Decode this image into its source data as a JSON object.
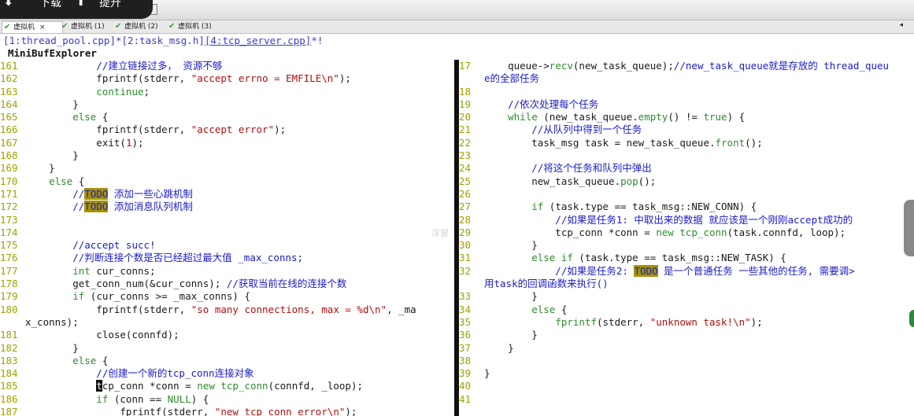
{
  "overlay": {
    "download_label": "下载",
    "submit_label": "提升"
  },
  "toolbar_icons": [
    "copy-icon",
    "paste-icon",
    "cut-icon",
    "undo-icon",
    "redo-icon",
    "print-icon",
    "properties-icon",
    "tools-icon",
    "light-icon",
    "help-icon",
    "display-icon"
  ],
  "vm_tabs": [
    {
      "label": "虚拟机",
      "close": "×"
    },
    {
      "label": "虚拟机 (1)"
    },
    {
      "label": "虚拟机 (2)"
    },
    {
      "label": "虚拟机 (3)"
    }
  ],
  "tab_arrow": "◂",
  "buffers": {
    "b1": "[1:thread_pool.cpp]*",
    "b2": "[2:task_msg.h]",
    "b3": "[4:tcp_server.cpp]",
    "b3_suffix": "*!"
  },
  "minibuf_title": "MiniBufExplorer",
  "watermark_text": "浮窗",
  "left_lines": [
    [
      "161",
      [
        [
          "c",
          "            //建立链接过多， 资源不够"
        ]
      ]
    ],
    [
      "162",
      [
        [
          "t",
          "            fprintf(stderr, "
        ],
        [
          "s",
          "\"accept errno = EMFILE\\n\""
        ],
        [
          "t",
          ");"
        ]
      ]
    ],
    [
      "163",
      [
        [
          "k",
          "            continue"
        ],
        [
          "t",
          ";"
        ]
      ]
    ],
    [
      "164",
      [
        [
          "t",
          "        }"
        ]
      ]
    ],
    [
      "165",
      [
        [
          "k",
          "        else"
        ],
        [
          "t",
          " {"
        ]
      ]
    ],
    [
      "166",
      [
        [
          "t",
          "            fprintf(stderr, "
        ],
        [
          "s",
          "\"accept error\""
        ],
        [
          "t",
          ");"
        ]
      ]
    ],
    [
      "167",
      [
        [
          "t",
          "            exit("
        ],
        [
          "s",
          "1"
        ],
        [
          "t",
          ");"
        ]
      ]
    ],
    [
      "168",
      [
        [
          "t",
          "        }"
        ]
      ]
    ],
    [
      "169",
      [
        [
          "t",
          "    }"
        ]
      ]
    ],
    [
      "170",
      [
        [
          "k",
          "    else"
        ],
        [
          "t",
          " {"
        ]
      ]
    ],
    [
      "171",
      [
        [
          "c",
          "        //"
        ],
        [
          "o",
          "TODO"
        ],
        [
          "c",
          " 添加一些心跳机制"
        ]
      ]
    ],
    [
      "172",
      [
        [
          "c",
          "        //"
        ],
        [
          "o",
          "TODO"
        ],
        [
          "c",
          " 添加消息队列机制"
        ]
      ]
    ],
    [
      "173",
      []
    ],
    [
      "174",
      []
    ],
    [
      "175",
      [
        [
          "c",
          "        //accept succ!"
        ]
      ]
    ],
    [
      "176",
      [
        [
          "c",
          "        //判断连接个数是否已经超过最大值 _max_conns;"
        ]
      ]
    ],
    [
      "177",
      [
        [
          "k",
          "        int"
        ],
        [
          "t",
          " cur_conns;"
        ]
      ]
    ],
    [
      "178",
      [
        [
          "t",
          "        get_conn_num(&cur_conns); "
        ],
        [
          "c",
          "//获取当前在线的连接个数"
        ]
      ]
    ],
    [
      "179",
      [
        [
          "k",
          "        if"
        ],
        [
          "t",
          " (cur_conns >= _max_conns) {"
        ]
      ]
    ],
    [
      "180",
      [
        [
          "t",
          "            fprintf(stderr, "
        ],
        [
          "s",
          "\"so many connections, max = %d\\n\""
        ],
        [
          "t",
          ", _ma"
        ]
      ]
    ],
    [
      "",
      [
        [
          "t",
          "x_conns);"
        ]
      ]
    ],
    [
      "181",
      [
        [
          "t",
          "            close(connfd);"
        ]
      ]
    ],
    [
      "182",
      [
        [
          "t",
          "        }"
        ]
      ]
    ],
    [
      "183",
      [
        [
          "k",
          "        else"
        ],
        [
          "t",
          " {"
        ]
      ]
    ],
    [
      "184",
      [
        [
          "c",
          "            //创建一个新的tcp_conn连接对象"
        ]
      ]
    ],
    [
      "185",
      [
        [
          "t",
          "            "
        ],
        [
          "u",
          "t"
        ],
        [
          "t",
          "cp_conn *conn = "
        ],
        [
          "k",
          "new"
        ],
        [
          "t",
          " "
        ],
        [
          "k",
          "tcp_conn"
        ],
        [
          "t",
          "(connfd, _loop);"
        ]
      ]
    ],
    [
      "186",
      [
        [
          "k",
          "            if"
        ],
        [
          "t",
          " (conn == "
        ],
        [
          "k",
          "NULL"
        ],
        [
          "t",
          ") {"
        ]
      ]
    ],
    [
      "187",
      [
        [
          "t",
          "                fprintf(stderr, "
        ],
        [
          "s",
          "\"new tcp_conn error\\n\""
        ],
        [
          "t",
          ");"
        ]
      ]
    ]
  ],
  "right_lines": [
    [
      "17",
      [
        [
          "t",
          "    queue->"
        ],
        [
          "k",
          "recv"
        ],
        [
          "t",
          "(new_task_queue);"
        ],
        [
          "c",
          "//new_task_queue就是存放的 thread_queu"
        ]
      ]
    ],
    [
      "",
      [
        [
          "c",
          "e的全部任务"
        ]
      ]
    ],
    [
      "18",
      []
    ],
    [
      "19",
      [
        [
          "c",
          "    //依次处理每个任务"
        ]
      ]
    ],
    [
      "20",
      [
        [
          "k",
          "    while"
        ],
        [
          "t",
          " (new_task_queue."
        ],
        [
          "k",
          "empty"
        ],
        [
          "t",
          "() != "
        ],
        [
          "k",
          "true"
        ],
        [
          "t",
          ") {"
        ]
      ]
    ],
    [
      "21",
      [
        [
          "c",
          "        //从队列中得到一个任务"
        ]
      ]
    ],
    [
      "22",
      [
        [
          "t",
          "        task_msg task = new_task_queue."
        ],
        [
          "k",
          "front"
        ],
        [
          "t",
          "();"
        ]
      ]
    ],
    [
      "23",
      []
    ],
    [
      "24",
      [
        [
          "c",
          "        //将这个任务和队列中弹出"
        ]
      ]
    ],
    [
      "25",
      [
        [
          "t",
          "        new_task_queue."
        ],
        [
          "k",
          "pop"
        ],
        [
          "t",
          "();"
        ]
      ]
    ],
    [
      "26",
      []
    ],
    [
      "27",
      [
        [
          "k",
          "        if"
        ],
        [
          "t",
          " (task.type == task_msg::NEW_CONN) {"
        ]
      ]
    ],
    [
      "28",
      [
        [
          "c",
          "            //如果是任务1: 中取出来的数据 就应该是一个刚刚accept成功的"
        ]
      ]
    ],
    [
      "29",
      [
        [
          "t",
          "            tcp_conn *conn = "
        ],
        [
          "k",
          "new"
        ],
        [
          "t",
          " "
        ],
        [
          "k",
          "tcp_conn"
        ],
        [
          "t",
          "(task.connfd, loop);"
        ]
      ]
    ],
    [
      "30",
      [
        [
          "t",
          "        }"
        ]
      ]
    ],
    [
      "31",
      [
        [
          "k",
          "        else if"
        ],
        [
          "t",
          " (task.type == task_msg::NEW_TASK) {"
        ]
      ]
    ],
    [
      "32",
      [
        [
          "c",
          "            //如果是任务2: "
        ],
        [
          "o",
          "TODO"
        ],
        [
          "c",
          " 是一个普通任务 一些其他的任务, 需要调>"
        ]
      ]
    ],
    [
      "",
      [
        [
          "c",
          "用task的回调函数来执行()"
        ]
      ]
    ],
    [
      "33",
      [
        [
          "t",
          "        }"
        ]
      ]
    ],
    [
      "34",
      [
        [
          "k",
          "        else"
        ],
        [
          "t",
          " {"
        ]
      ]
    ],
    [
      "35",
      [
        [
          "t",
          "            "
        ],
        [
          "k",
          "fprintf"
        ],
        [
          "t",
          "(stderr, "
        ],
        [
          "s",
          "\"unknown task!\\n\""
        ],
        [
          "t",
          ");"
        ]
      ]
    ],
    [
      "36",
      [
        [
          "t",
          "        }"
        ]
      ]
    ],
    [
      "37",
      [
        [
          "t",
          "    }"
        ]
      ]
    ],
    [
      "38",
      []
    ],
    [
      "39",
      [
        [
          "t",
          "}"
        ]
      ]
    ],
    [
      "40",
      []
    ],
    [
      "41",
      []
    ]
  ]
}
